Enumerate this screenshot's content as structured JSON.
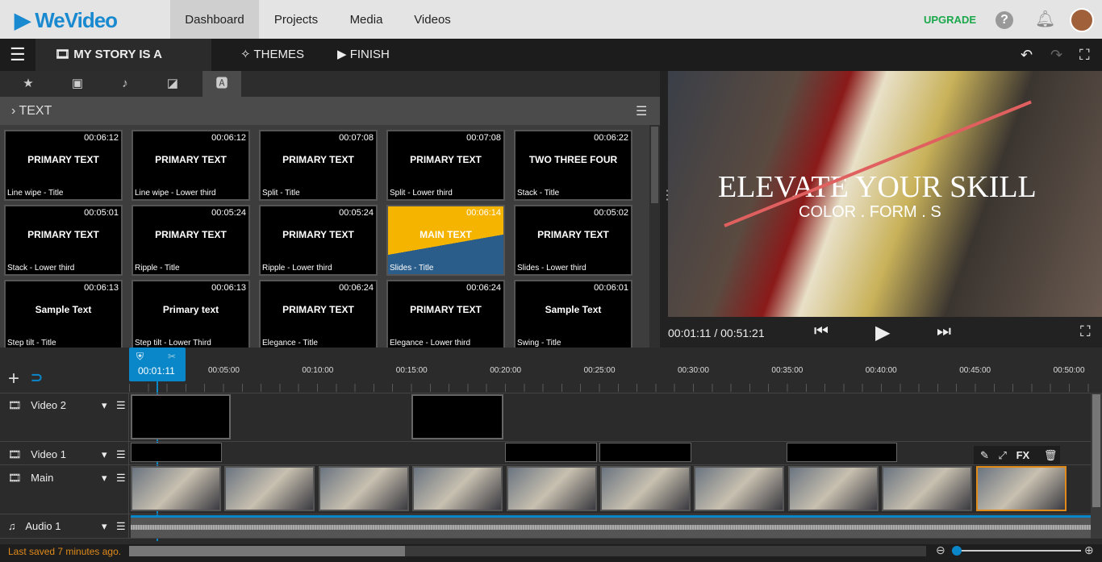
{
  "header": {
    "logo": "WeVideo",
    "nav": [
      "Dashboard",
      "Projects",
      "Media",
      "Videos"
    ],
    "upgrade": "UPGRADE",
    "help": "?"
  },
  "toolbar": {
    "project": "MY STORY IS A CANVAS",
    "themes": "THEMES",
    "finish": "FINISH"
  },
  "panel": {
    "section": "TEXT",
    "tiles": [
      {
        "dur": "00:06:12",
        "title": "Line wipe - Title",
        "pv": "PRIMARY TEXT"
      },
      {
        "dur": "00:06:12",
        "title": "Line wipe - Lower third",
        "pv": "PRIMARY TEXT"
      },
      {
        "dur": "00:07:08",
        "title": "Split - Title",
        "pv": "PRIMARY TEXT"
      },
      {
        "dur": "00:07:08",
        "title": "Split - Lower third",
        "pv": "PRIMARY TEXT"
      },
      {
        "dur": "00:06:22",
        "title": "Stack - Title",
        "pv": "TWO THREE FOUR"
      },
      {
        "dur": "00:05:01",
        "title": "Stack - Lower third",
        "pv": "PRIMARY TEXT"
      },
      {
        "dur": "00:05:24",
        "title": "Ripple - Title",
        "pv": "PRIMARY TEXT"
      },
      {
        "dur": "00:05:24",
        "title": "Ripple - Lower third",
        "pv": "PRIMARY TEXT"
      },
      {
        "dur": "00:06:14",
        "title": "Slides - Title",
        "pv": "MAIN TEXT"
      },
      {
        "dur": "00:05:02",
        "title": "Slides - Lower third",
        "pv": "PRIMARY TEXT"
      },
      {
        "dur": "00:06:13",
        "title": "Step tilt - Title",
        "pv": "Sample Text"
      },
      {
        "dur": "00:06:13",
        "title": "Step tilt - Lower Third",
        "pv": "Primary text"
      },
      {
        "dur": "00:06:24",
        "title": "Elegance - Title",
        "pv": "PRIMARY TEXT"
      },
      {
        "dur": "00:06:24",
        "title": "Elegance - Lower third",
        "pv": "PRIMARY TEXT"
      },
      {
        "dur": "00:06:01",
        "title": "Swing - Title",
        "pv": "Sample Text"
      }
    ]
  },
  "preview": {
    "headline": "ELEVATE YOUR SKILL",
    "sub": "COLOR . FORM . S",
    "time": "00:01:11 / 00:51:21"
  },
  "timeline": {
    "playhead": "00:01:11",
    "ticks": [
      "00:05:00",
      "00:10:00",
      "00:15:00",
      "00:20:00",
      "00:25:00",
      "00:30:00",
      "00:35:00",
      "00:40:00",
      "00:45:00",
      "00:50:00"
    ],
    "tracks": [
      "Video 2",
      "Video 1",
      "Main",
      "Audio 1"
    ],
    "fx": "FX"
  },
  "footer": {
    "saved": "Last saved 7 minutes ago."
  },
  "colors": {
    "accent": "#0a87c9",
    "upgrade": "#1aa84a",
    "saved": "#e08a1a"
  }
}
